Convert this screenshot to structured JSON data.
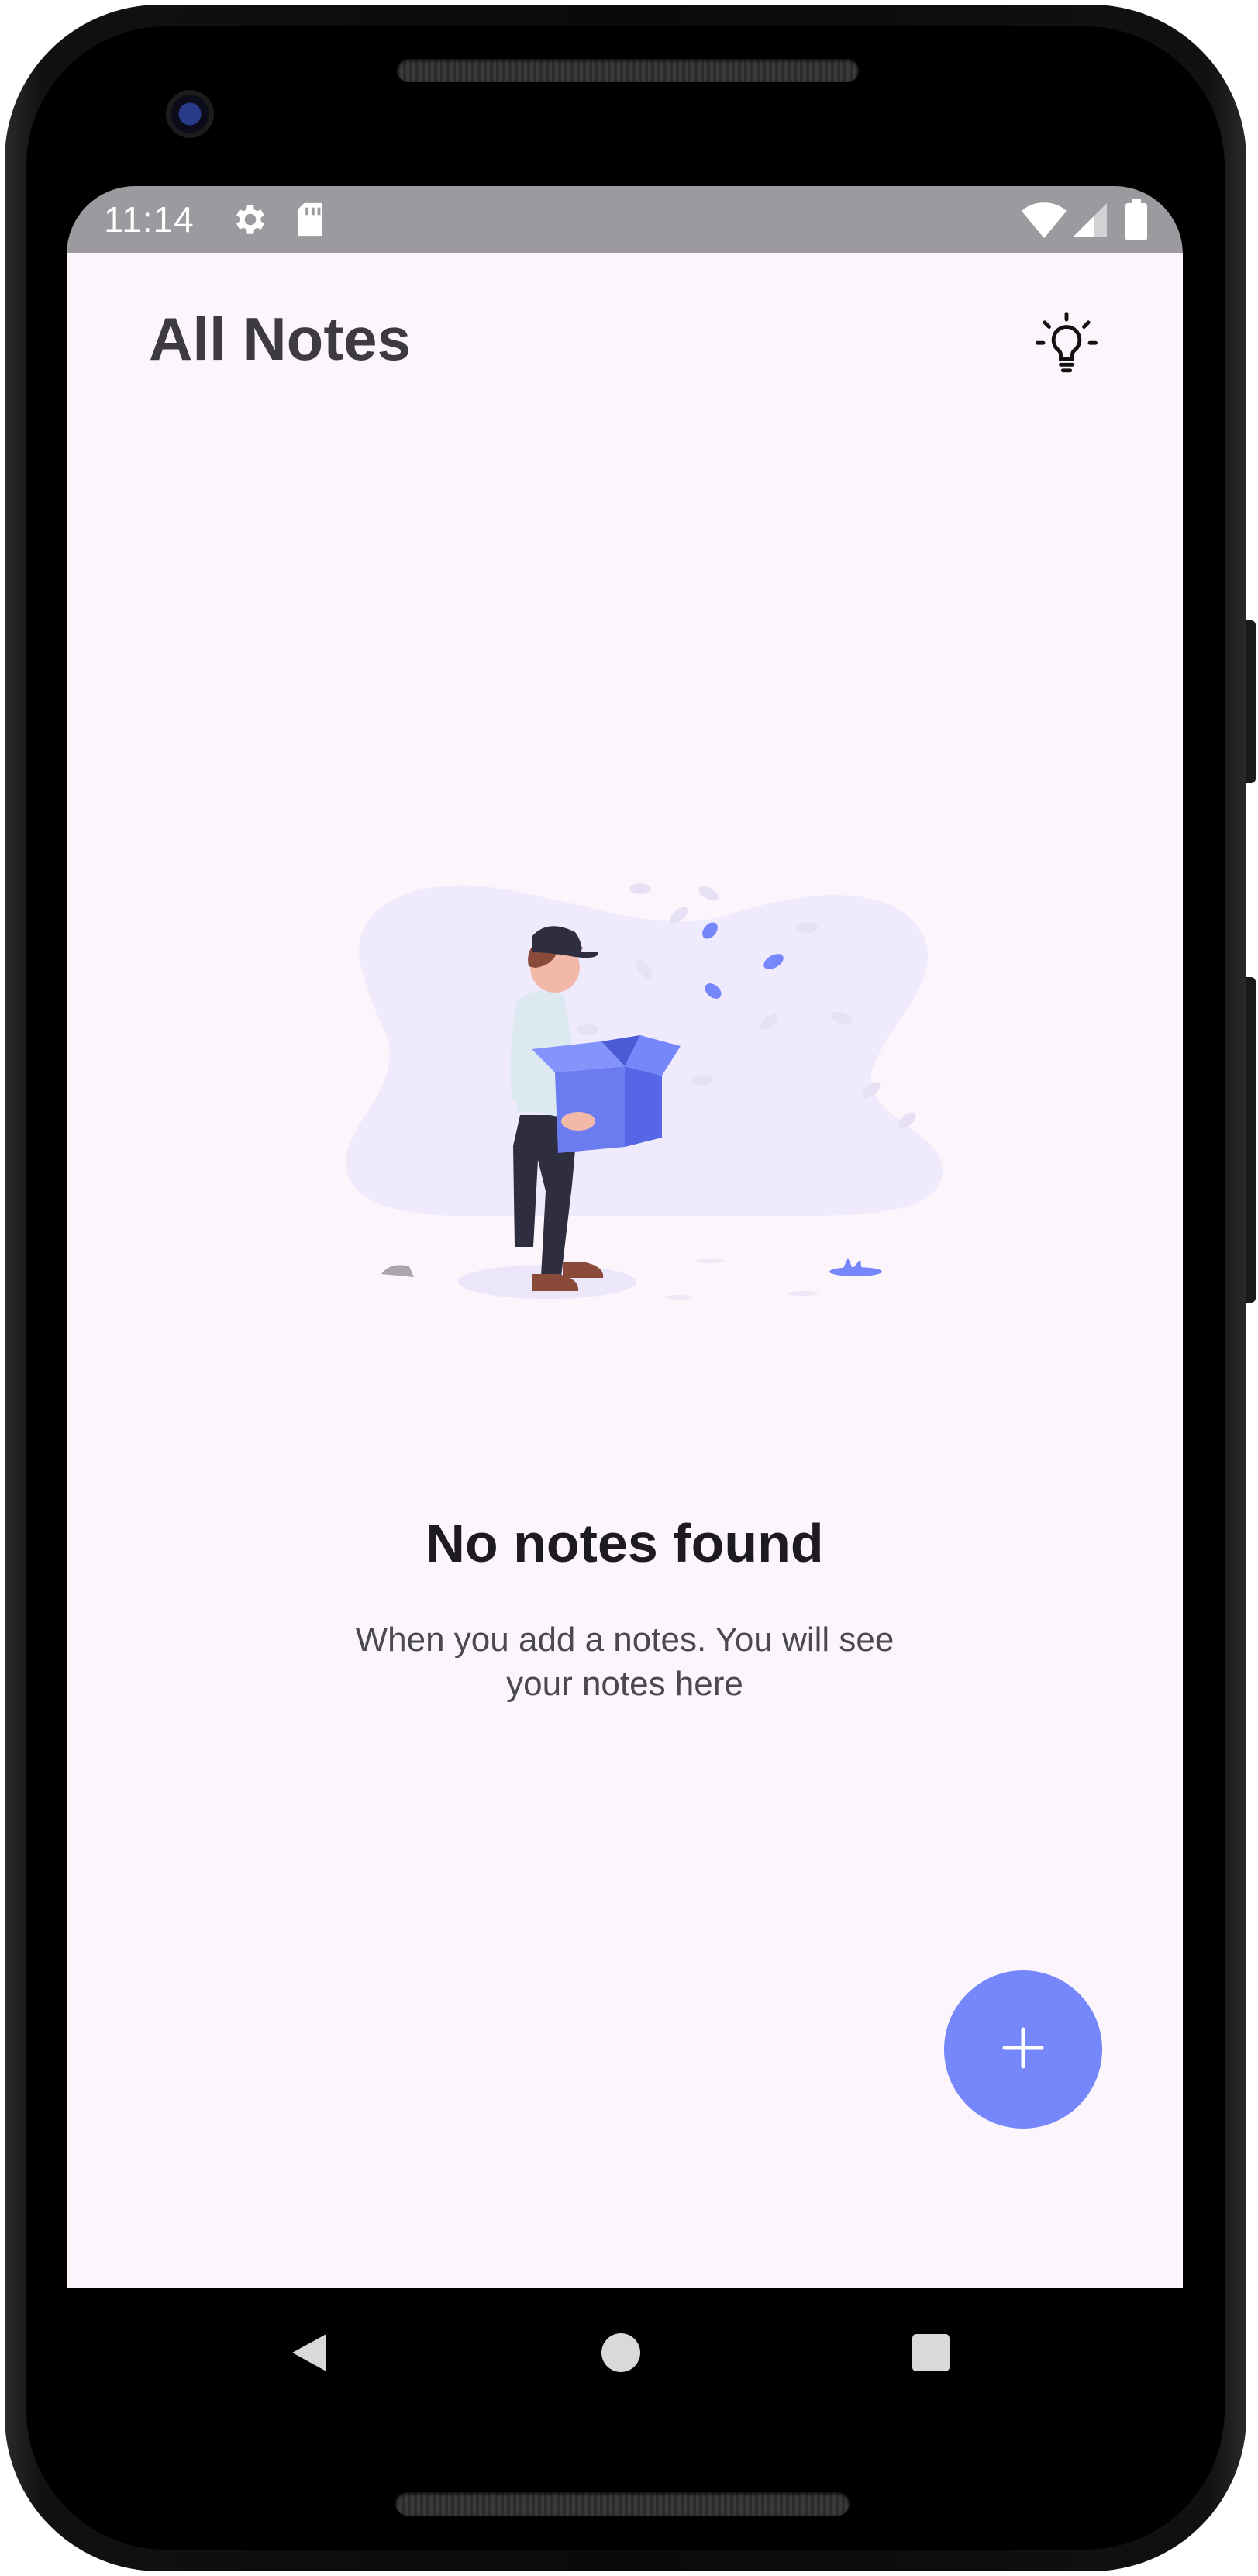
{
  "status_bar": {
    "time": "11:14",
    "icons": [
      "settings-icon",
      "sd-card-icon",
      "wifi-icon",
      "signal-icon",
      "battery-icon"
    ]
  },
  "header": {
    "title": "All Notes",
    "theme_icon": "lightbulb-icon"
  },
  "empty_state": {
    "illustration": "man-holding-empty-box-illustration",
    "title": "No notes found",
    "description": "When you add a notes. You will see your notes here"
  },
  "fab": {
    "icon": "plus-icon"
  },
  "nav_bar": {
    "buttons": [
      "back-icon",
      "home-icon",
      "recents-icon"
    ]
  },
  "colors": {
    "status_bar": "#9c9a9f",
    "background": "#fcf6fc",
    "accent": "#7587fa",
    "title_text": "#3d3b40",
    "body_text": "#4a4850"
  }
}
